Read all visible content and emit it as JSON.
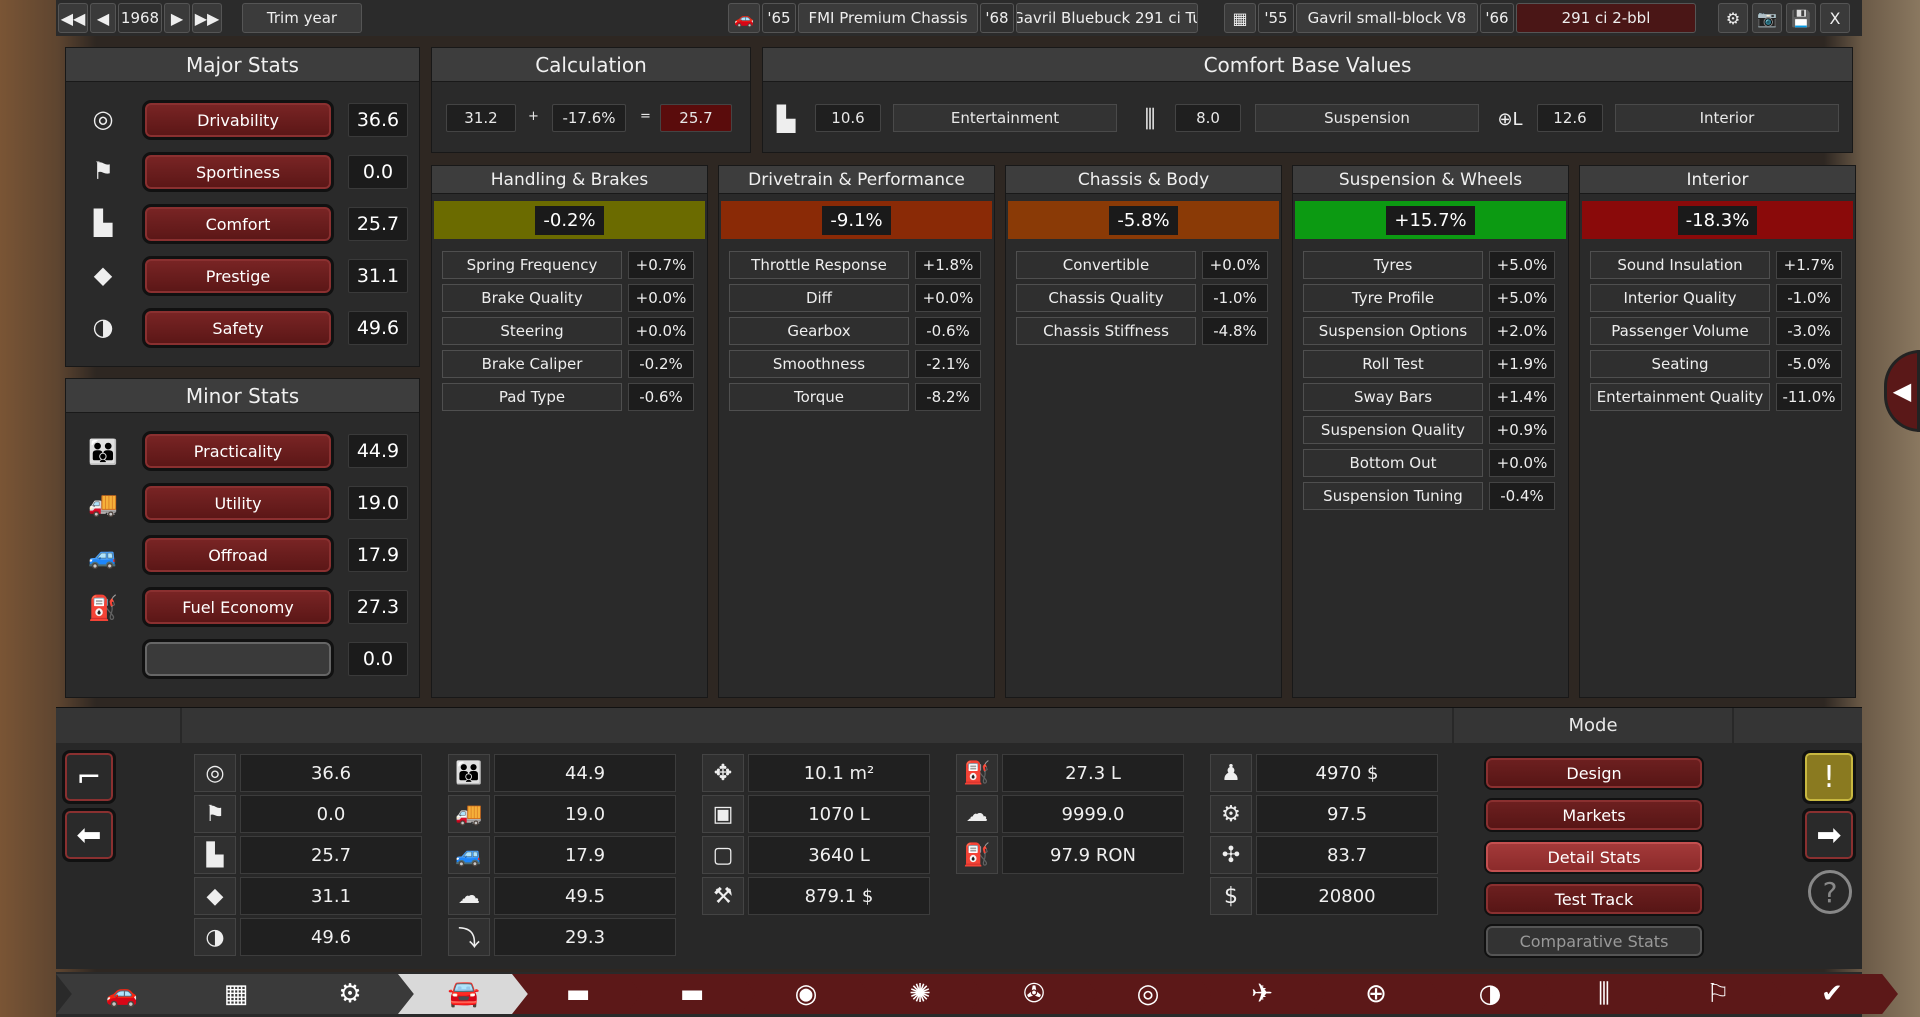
{
  "topbar": {
    "year": "1968",
    "trim_year_label": "Trim year",
    "chassis_year": "'65",
    "chassis": "FMI Premium Chassis",
    "body_year": "'68",
    "body": "Gavril Bluebuck 291 ci Tu",
    "engine_year": "'55",
    "engine": "Gavril small-block V8",
    "variant_year": "'66",
    "variant": "291 ci 2-bbl",
    "close_label": "X"
  },
  "major_stats": {
    "title": "Major Stats",
    "items": [
      {
        "label": "Drivability",
        "value": "36.6",
        "icon": "steering-wheel-icon"
      },
      {
        "label": "Sportiness",
        "value": "0.0",
        "icon": "checkered-flag-icon"
      },
      {
        "label": "Comfort",
        "value": "25.7",
        "icon": "seat-icon"
      },
      {
        "label": "Prestige",
        "value": "31.1",
        "icon": "diamond-icon"
      },
      {
        "label": "Safety",
        "value": "49.6",
        "icon": "crash-test-icon"
      }
    ]
  },
  "minor_stats": {
    "title": "Minor Stats",
    "items": [
      {
        "label": "Practicality",
        "value": "44.9",
        "icon": "family-icon"
      },
      {
        "label": "Utility",
        "value": "19.0",
        "icon": "truck-icon"
      },
      {
        "label": "Offroad",
        "value": "17.9",
        "icon": "offroad-icon"
      },
      {
        "label": "Fuel Economy",
        "value": "27.3",
        "icon": "fuel-can-icon"
      },
      {
        "label": "",
        "value": "0.0",
        "icon": ""
      }
    ]
  },
  "calculation": {
    "title": "Calculation",
    "base": "31.2",
    "plus": "+",
    "modifier": "-17.6%",
    "equals": "=",
    "result": "25.7"
  },
  "comfort_base": {
    "title": "Comfort Base Values",
    "entertainment_value": "10.6",
    "entertainment_label": "Entertainment",
    "suspension_value": "8.0",
    "suspension_label": "Suspension",
    "interior_value": "12.6",
    "interior_label": "Interior"
  },
  "categories": [
    {
      "title": "Handling & Brakes",
      "total": "-0.2%",
      "color": "#6b6b00",
      "rows": [
        [
          "Spring Frequency",
          "+0.7%"
        ],
        [
          "Brake Quality",
          "+0.0%"
        ],
        [
          "Steering",
          "+0.0%"
        ],
        [
          "Brake Caliper",
          "-0.2%"
        ],
        [
          "Pad Type",
          "-0.6%"
        ]
      ]
    },
    {
      "title": "Drivetrain & Performance",
      "total": "-9.1%",
      "color": "#8a2a06",
      "rows": [
        [
          "Throttle Response",
          "+1.8%"
        ],
        [
          "Diff",
          "+0.0%"
        ],
        [
          "Gearbox",
          "-0.6%"
        ],
        [
          "Smoothness",
          "-2.1%"
        ],
        [
          "Torque",
          "-8.2%"
        ]
      ]
    },
    {
      "title": "Chassis & Body",
      "total": "-5.8%",
      "color": "#8a3a06",
      "rows": [
        [
          "Convertible",
          "+0.0%"
        ],
        [
          "Chassis Quality",
          "-1.0%"
        ],
        [
          "Chassis Stiffness",
          "-4.8%"
        ]
      ]
    },
    {
      "title": "Suspension & Wheels",
      "total": "+15.7%",
      "color": "#0c9a12",
      "rows": [
        [
          "Tyres",
          "+5.0%"
        ],
        [
          "Tyre Profile",
          "+5.0%"
        ],
        [
          "Suspension Options",
          "+2.0%"
        ],
        [
          "Roll Test",
          "+1.9%"
        ],
        [
          "Sway Bars",
          "+1.4%"
        ],
        [
          "Suspension Quality",
          "+0.9%"
        ],
        [
          "Bottom Out",
          "+0.0%"
        ],
        [
          "Suspension Tuning",
          "-0.4%"
        ]
      ]
    },
    {
      "title": "Interior",
      "total": "-18.3%",
      "color": "#8a0a0a",
      "rows": [
        [
          "Sound Insulation",
          "+1.7%"
        ],
        [
          "Interior Quality",
          "-1.0%"
        ],
        [
          "Passenger Volume",
          "-3.0%"
        ],
        [
          "Seating",
          "-5.0%"
        ],
        [
          "Entertainment Quality",
          "-11.0%"
        ]
      ]
    }
  ],
  "summary": {
    "col1": [
      [
        "steering-wheel-icon",
        "36.6"
      ],
      [
        "checkered-flag-icon",
        "0.0"
      ],
      [
        "seat-icon",
        "25.7"
      ],
      [
        "diamond-icon",
        "31.1"
      ],
      [
        "crash-test-icon",
        "49.6"
      ]
    ],
    "col2": [
      [
        "family-icon",
        "44.9"
      ],
      [
        "truck-icon",
        "19.0"
      ],
      [
        "offroad-icon",
        "17.9"
      ],
      [
        "environment-icon",
        "49.5"
      ],
      [
        "downhill-icon",
        "29.3"
      ]
    ],
    "col3": [
      [
        "dimensions-icon",
        "10.1 m²"
      ],
      [
        "cargo-volume-icon",
        "1070 L"
      ],
      [
        "passenger-volume-icon",
        "3640 L"
      ],
      [
        "service-cost-icon",
        "879.1 $"
      ]
    ],
    "col4": [
      [
        "fuel-can-icon",
        "27.3 L"
      ],
      [
        "emissions-icon",
        "9999.0"
      ],
      [
        "fuel-pump-icon",
        "97.9 RON"
      ]
    ],
    "col5": [
      [
        "engineer-cost-icon",
        "4970 $"
      ],
      [
        "production-units-icon",
        "97.5"
      ],
      [
        "workhours-icon",
        "83.7"
      ],
      [
        "price-icon",
        "20800"
      ]
    ]
  },
  "mode": {
    "title": "Mode",
    "buttons": [
      "Design",
      "Markets",
      "Detail Stats",
      "Test Track",
      "Comparative Stats"
    ]
  },
  "tabs": [
    "car-body-icon",
    "engine-block-icon",
    "suspension-parts-icon",
    "car-shape-icon",
    "seats-icon",
    "fixtures-icon",
    "headlights-icon",
    "brakes-icon",
    "wheels-icon",
    "tyres-icon",
    "aero-icon",
    "interior-icon",
    "safety-icon",
    "tuning-icon",
    "test-icon",
    "confirm-icon"
  ]
}
